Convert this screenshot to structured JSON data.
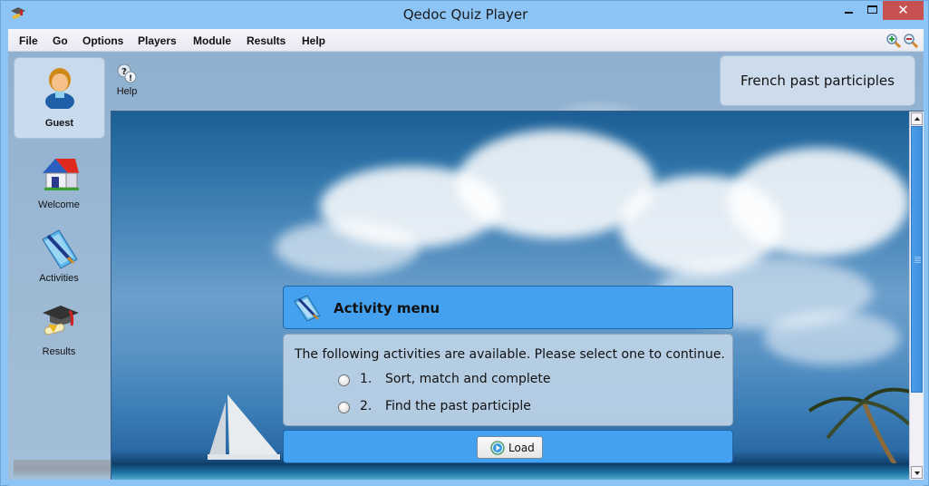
{
  "window": {
    "title": "Qedoc Quiz Player",
    "controls": {
      "minimize": "minimize",
      "maximize": "maximize",
      "close": "✕"
    }
  },
  "menu": {
    "items": [
      "File",
      "Go",
      "Options",
      "Players",
      "Module",
      "Results",
      "Help"
    ],
    "icons": [
      "zoom-in-icon",
      "zoom-out-icon"
    ]
  },
  "user": {
    "name": "Guest",
    "icon": "user-avatar-icon"
  },
  "toolbar": {
    "help_label": "Help",
    "help_icon": "help-icon"
  },
  "sidebar": {
    "items": [
      {
        "label": "Welcome",
        "icon": "house-icon"
      },
      {
        "label": "Activities",
        "icon": "book-pen-icon"
      },
      {
        "label": "Results",
        "icon": "graduation-cap-icon"
      }
    ]
  },
  "module": {
    "title": "French past participles"
  },
  "activity_menu": {
    "heading": "Activity menu",
    "intro": "The following activities are available. Please select one to continue.",
    "options": [
      {
        "number": "1.",
        "label": "Sort, match and complete",
        "selected": false
      },
      {
        "number": "2.",
        "label": "Find the past participle",
        "selected": false
      }
    ],
    "load_label": "Load"
  },
  "scrollbar": {
    "position_fraction": 0.0,
    "visible_fraction": 0.79
  },
  "colors": {
    "panel_blue": "#43a1f0",
    "close_red": "#c75050",
    "window_frame": "#8cc4f5"
  }
}
